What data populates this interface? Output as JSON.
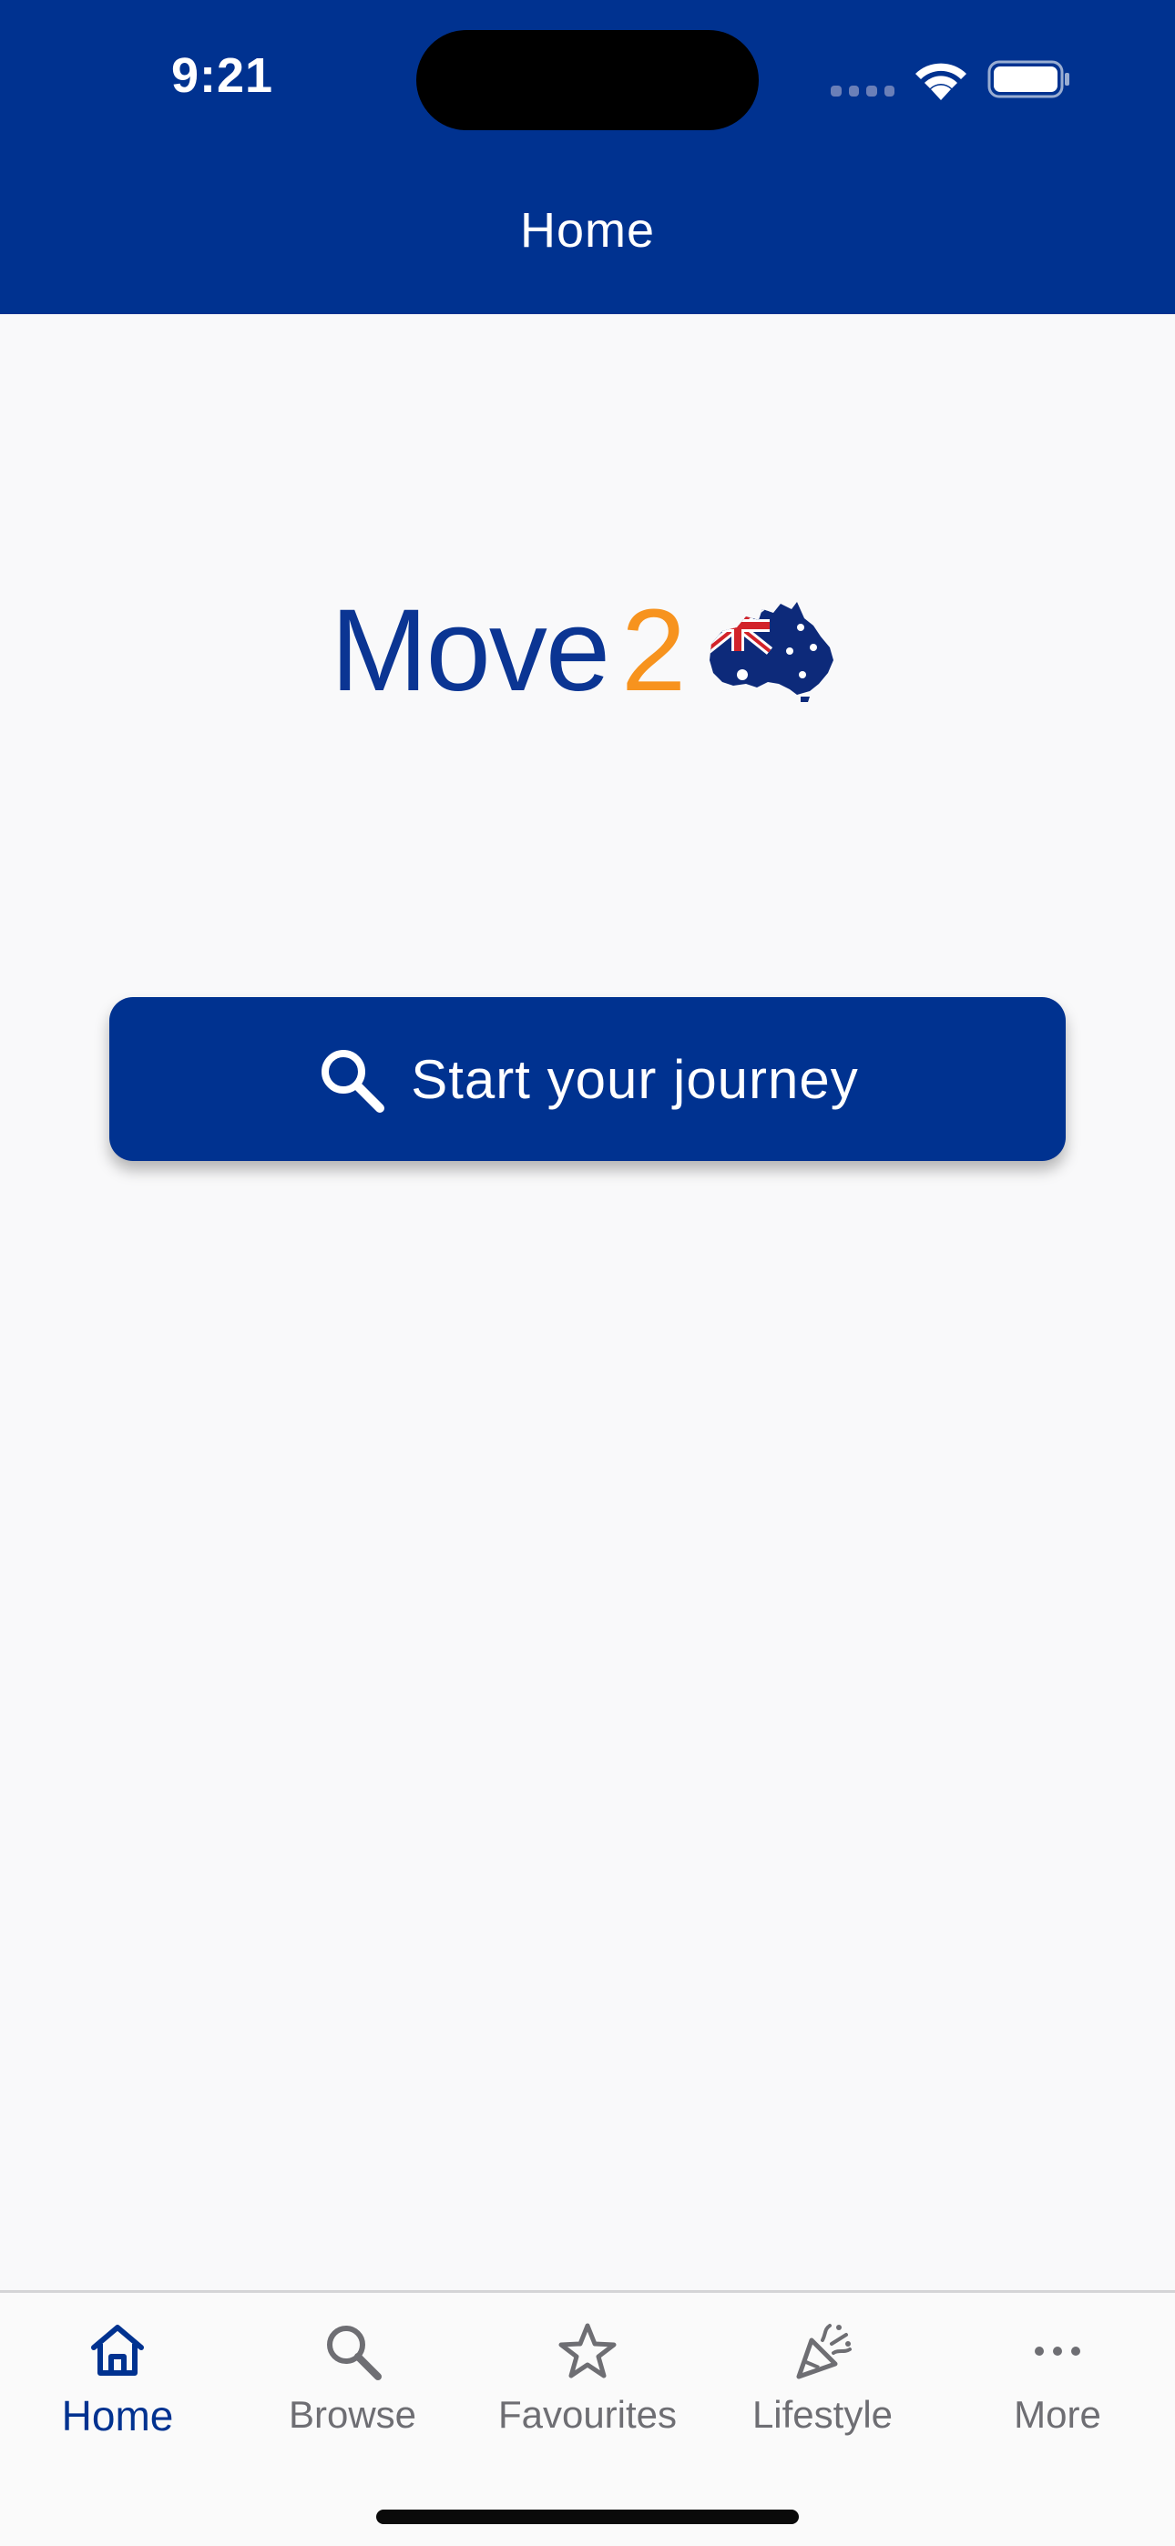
{
  "status_bar": {
    "time": "9:21"
  },
  "header": {
    "title": "Home"
  },
  "logo": {
    "word": "Move",
    "number": "2",
    "map_icon": "australia-flag-map-icon"
  },
  "main": {
    "journey_button": {
      "label": "Start your journey",
      "icon": "search-icon"
    }
  },
  "bottom_nav": {
    "items": [
      {
        "label": "Home",
        "icon": "home-icon",
        "active": true
      },
      {
        "label": "Browse",
        "icon": "search-icon",
        "active": false
      },
      {
        "label": "Favourites",
        "icon": "star-icon",
        "active": false
      },
      {
        "label": "Lifestyle",
        "icon": "party-popper-icon",
        "active": false
      },
      {
        "label": "More",
        "icon": "more-dots-icon",
        "active": false
      }
    ]
  },
  "colors": {
    "brand_blue": "#003290",
    "accent_orange": "#f7931e",
    "background": "#f9f9fa",
    "inactive_gray": "#6e6e73"
  }
}
